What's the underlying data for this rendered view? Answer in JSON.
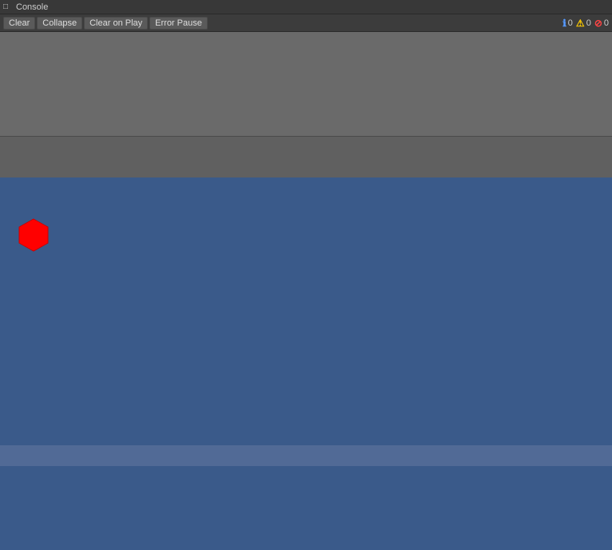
{
  "console": {
    "title": "Console",
    "checkbox_label": "□",
    "buttons": {
      "clear": "Clear",
      "collapse": "Collapse",
      "clear_on_play": "Clear on Play",
      "error_pause": "Error Pause"
    },
    "counters": {
      "info_count": "0",
      "warn_count": "0",
      "error_count": "0"
    }
  },
  "scene": {
    "hexagon_color": "#ff0000"
  },
  "icons": {
    "info": "ℹ",
    "warn": "⚠",
    "error": "⊘",
    "checkbox": "□"
  }
}
